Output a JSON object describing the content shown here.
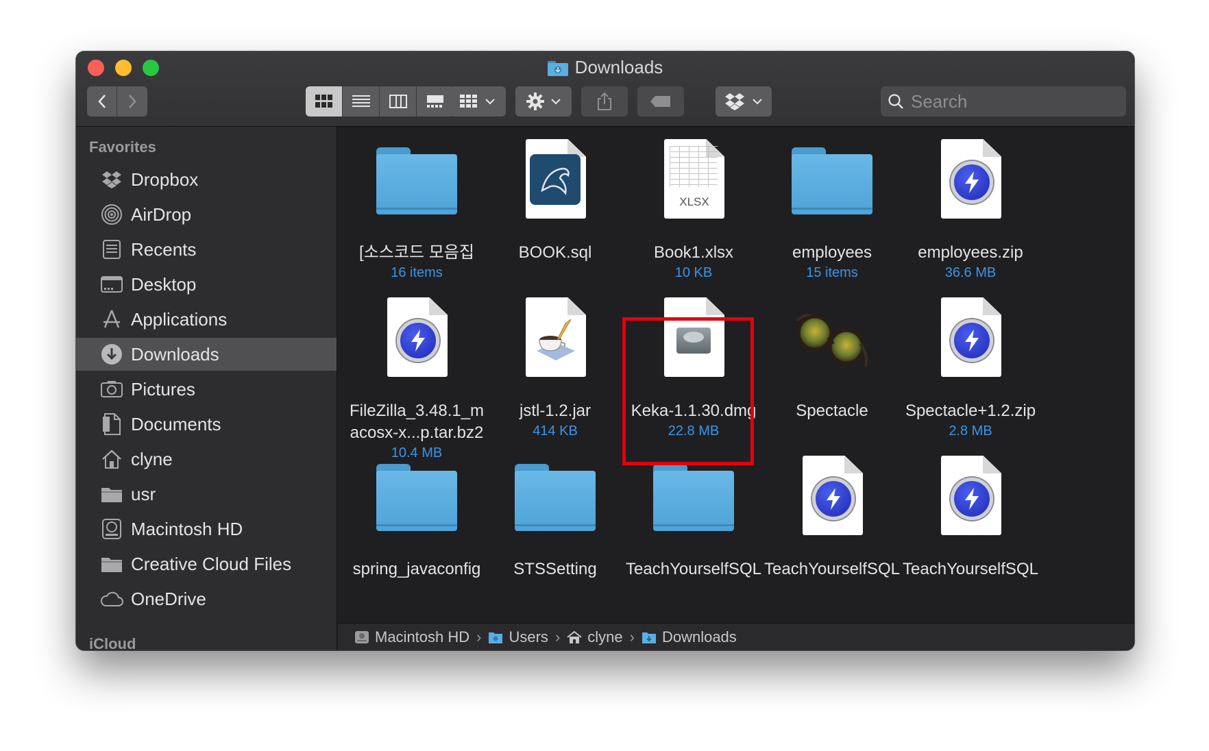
{
  "window": {
    "title": "Downloads"
  },
  "toolbar": {
    "back_glyph": "‹",
    "forward_glyph": "›",
    "view_modes": [
      "icon-view",
      "list-view",
      "column-view",
      "gallery-view"
    ],
    "active_view": "icon-view",
    "search_placeholder": "Search"
  },
  "sidebar": {
    "header": "Favorites",
    "items": [
      {
        "label": "Dropbox",
        "icon": "dropbox-icon",
        "selected": false
      },
      {
        "label": "AirDrop",
        "icon": "airdrop-icon",
        "selected": false
      },
      {
        "label": "Recents",
        "icon": "recents-icon",
        "selected": false
      },
      {
        "label": "Desktop",
        "icon": "desktop-icon",
        "selected": false
      },
      {
        "label": "Applications",
        "icon": "applications-icon",
        "selected": false
      },
      {
        "label": "Downloads",
        "icon": "downloads-icon",
        "selected": true
      },
      {
        "label": "Pictures",
        "icon": "pictures-icon",
        "selected": false
      },
      {
        "label": "Documents",
        "icon": "documents-icon",
        "selected": false
      },
      {
        "label": "clyne",
        "icon": "home-icon",
        "selected": false
      },
      {
        "label": "usr",
        "icon": "folder-icon",
        "selected": false
      },
      {
        "label": "Macintosh HD",
        "icon": "hard-drive-icon",
        "selected": false
      },
      {
        "label": "Creative Cloud Files",
        "icon": "folder-icon",
        "selected": false
      },
      {
        "label": "OneDrive",
        "icon": "cloud-icon",
        "selected": false
      }
    ],
    "cut_header": "iCloud"
  },
  "files": [
    {
      "name": "[소스코드 모음집",
      "sub": "16 items",
      "kind": "folder"
    },
    {
      "name": "BOOK.sql",
      "sub": "",
      "kind": "mysql"
    },
    {
      "name": "Book1.xlsx",
      "sub": "10 KB",
      "kind": "xlsx",
      "badge": "XLSX"
    },
    {
      "name": "employees",
      "sub": "15 items",
      "kind": "folder"
    },
    {
      "name": "employees.zip",
      "sub": "36.6 MB",
      "kind": "archive"
    },
    {
      "name": "FileZilla_3.48.1_m",
      "name2": "acosx-x...p.tar.bz2",
      "sub": "10.4 MB",
      "kind": "archive"
    },
    {
      "name": "jstl-1.2.jar",
      "sub": "414 KB",
      "kind": "jar"
    },
    {
      "name": "Keka-1.1.30.dmg",
      "sub": "22.8 MB",
      "kind": "dmg"
    },
    {
      "name": "Spectacle",
      "sub": "",
      "kind": "app"
    },
    {
      "name": "Spectacle+1.2.zip",
      "sub": "2.8 MB",
      "kind": "archive"
    },
    {
      "name": "spring_javaconfig",
      "sub": "",
      "kind": "folder"
    },
    {
      "name": "STSSetting",
      "sub": "",
      "kind": "folder"
    },
    {
      "name": "TeachYourselfSQL",
      "sub": "",
      "kind": "folder"
    },
    {
      "name": "TeachYourselfSQL",
      "sub": "",
      "kind": "archive"
    },
    {
      "name": "TeachYourselfSQL",
      "sub": "",
      "kind": "archive"
    }
  ],
  "pathbar": {
    "segments": [
      {
        "label": "Macintosh HD",
        "icon": "hard-drive-icon"
      },
      {
        "label": "Users",
        "icon": "folder-icon"
      },
      {
        "label": "clyne",
        "icon": "home-icon"
      },
      {
        "label": "Downloads",
        "icon": "downloads-folder-icon"
      }
    ],
    "separator": "›"
  },
  "colors": {
    "accent_blue": "#3b94e8",
    "highlight_red": "#e3000f",
    "folder_blue": "#5aaee0"
  }
}
